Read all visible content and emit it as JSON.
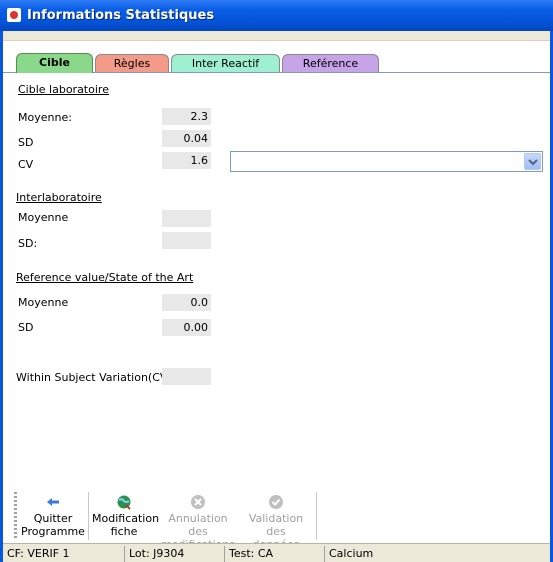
{
  "window": {
    "title": "Informations Statistiques",
    "icon": "app-icon"
  },
  "tabs": [
    {
      "label": "Cible",
      "color": "#8ad88a",
      "active": true
    },
    {
      "label": "Règles",
      "color": "#f49a88",
      "active": false
    },
    {
      "label": "Inter Reactif",
      "color": "#9ef0d0",
      "active": false
    },
    {
      "label": "Reférence",
      "color": "#c7a3e8",
      "active": false
    }
  ],
  "cible": {
    "heading": "Cible laboratoire",
    "moyenne_label": "Moyenne:",
    "moyenne_value": "2.3",
    "sd_label": "SD",
    "sd_value": "0.04",
    "cv_label": "CV",
    "cv_value": "1.6",
    "combo_value": ""
  },
  "inter": {
    "heading": "Interlaboratoire",
    "moyenne_label": "Moyenne",
    "moyenne_value": "",
    "sd_label": "SD:",
    "sd_value": ""
  },
  "reference": {
    "heading": "Reference value/State of the Art",
    "moyenne_label": "Moyenne",
    "moyenne_value": "0.0",
    "sd_label": "SD",
    "sd_value": "0.00"
  },
  "within": {
    "label": "Within Subject Variation(CV%)",
    "value": ""
  },
  "toolbar": {
    "quit": {
      "line1": "Quitter",
      "line2": "Programme",
      "icon": "arrow-left-icon"
    },
    "modify": {
      "line1": "Modification",
      "line2": "fiche",
      "icon": "globe-edit-icon"
    },
    "cancel": {
      "line1": "Annulation des",
      "line2": "modifications",
      "icon": "cancel-icon",
      "disabled": true
    },
    "validate": {
      "line1": "Validation des",
      "line2": "données",
      "icon": "check-icon",
      "disabled": true
    }
  },
  "status": {
    "cf": "CF: VERIF 1",
    "lot": "Lot: J9304",
    "test": "Test: CA",
    "analyte": "Calcium"
  }
}
